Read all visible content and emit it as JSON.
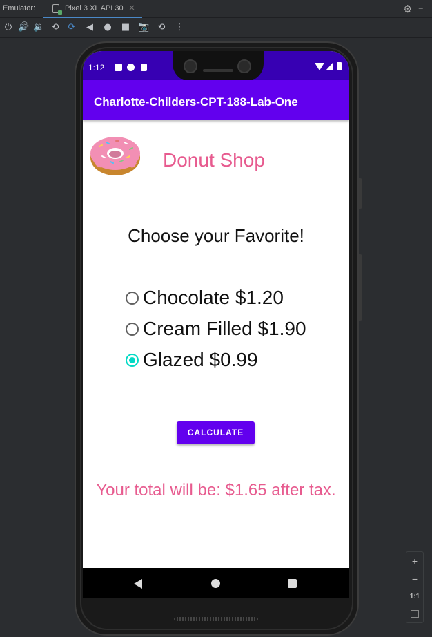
{
  "ide": {
    "emulator_label": "Emulator:",
    "tab_label": "Pixel 3 XL API 30",
    "tab_close": "×",
    "settings_glyph": "⚙",
    "minimize_glyph": "–",
    "toolbar_icons": [
      "power-icon",
      "volume-up-icon",
      "volume-down-icon",
      "rotate-left-icon",
      "rotate-right-icon",
      "back-icon",
      "home-icon",
      "overview-icon",
      "screenshot-icon",
      "snapshot-icon",
      "more-icon"
    ]
  },
  "zoom": {
    "zoom_in": "+",
    "zoom_out": "−",
    "actual_size": "1:1"
  },
  "device": {
    "status_time": "1:12"
  },
  "app": {
    "title": "Charlotte-Childers-CPT-188-Lab-One",
    "shop_name": "Donut Shop",
    "prompt": "Choose your Favorite!",
    "options": [
      {
        "label": "Chocolate $1.20",
        "selected": false
      },
      {
        "label": "Cream Filled $1.90",
        "selected": false
      },
      {
        "label": "Glazed $0.99",
        "selected": true
      }
    ],
    "calculate_label": "CALCULATE",
    "total_text": "Your total will be: $1.65 after tax."
  },
  "colors": {
    "status_bar": "#3700b3",
    "app_bar": "#6200ee",
    "accent_pink": "#e75b8f",
    "radio_selected": "#03dac5"
  }
}
